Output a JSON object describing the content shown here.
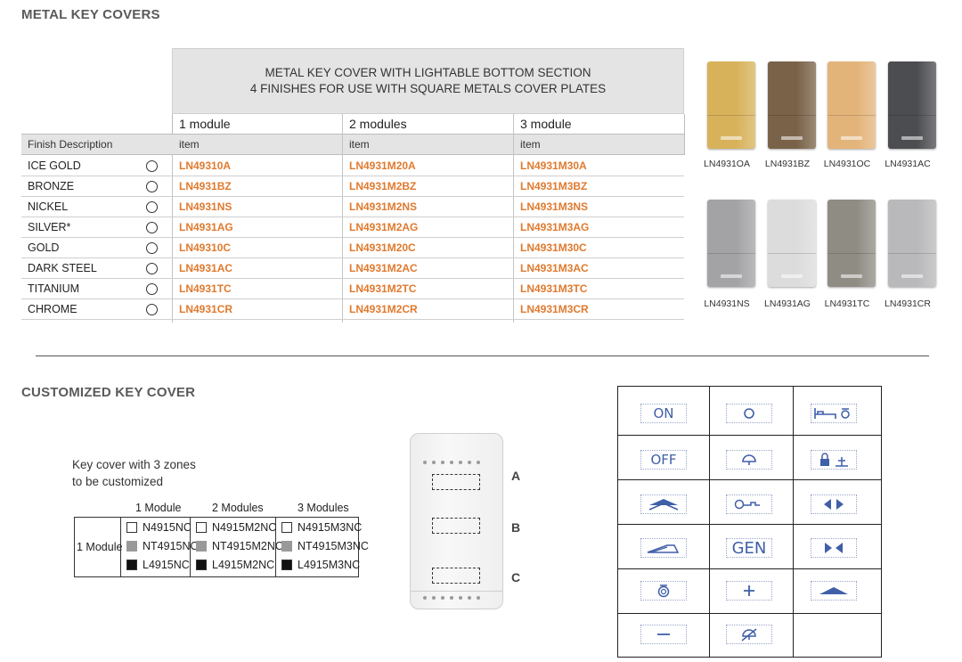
{
  "metal": {
    "title": "METAL KEY COVERS",
    "header_line1": "METAL KEY COVER WITH LIGHTABLE BOTTOM SECTION",
    "header_line2": "4 FINISHES FOR USE WITH SQUARE METALS COVER PLATES",
    "modules": [
      "1 module",
      "2 modules",
      "3 module"
    ],
    "finish_desc_label": "Finish Description",
    "item_label": "item",
    "rows": [
      {
        "finish": "ICE GOLD",
        "m1": "LN49310A",
        "m2": "LN4931M20A",
        "m3": "LN4931M30A"
      },
      {
        "finish": "BRONZE",
        "m1": "LN4931BZ",
        "m2": "LN4931M2BZ",
        "m3": "LN4931M3BZ"
      },
      {
        "finish": "NICKEL",
        "m1": "LN4931NS",
        "m2": "LN4931M2NS",
        "m3": "LN4931M3NS"
      },
      {
        "finish": "SILVER*",
        "m1": "LN4931AG",
        "m2": "LN4931M2AG",
        "m3": "LN4931M3AG"
      },
      {
        "finish": "GOLD",
        "m1": "LN49310C",
        "m2": "LN4931M20C",
        "m3": "LN4931M30C"
      },
      {
        "finish": "DARK STEEL",
        "m1": "LN4931AC",
        "m2": "LN4931M2AC",
        "m3": "LN4931M3AC"
      },
      {
        "finish": "TITANIUM",
        "m1": "LN4931TC",
        "m2": "LN4931M2TC",
        "m3": "LN4931M3TC"
      },
      {
        "finish": "CHROME",
        "m1": "LN4931CR",
        "m2": "LN4931M2CR",
        "m3": "LN4931M3CR"
      }
    ],
    "swatches": [
      {
        "label": "LN4931OA",
        "color": "#d8b25a"
      },
      {
        "label": "LN4931BZ",
        "color": "#7a6248"
      },
      {
        "label": "LN4931OC",
        "color": "#e3b47a"
      },
      {
        "label": "LN4931AC",
        "color": "#4b4d50"
      },
      {
        "label": "LN4931NS",
        "color": "#a3a3a5"
      },
      {
        "label": "LN4931AG",
        "color": "#dcdcdc"
      },
      {
        "label": "LN4931TC",
        "color": "#8f8c84"
      },
      {
        "label": "LN4931CR",
        "color": "#b9b9bb"
      }
    ],
    "accent_color": "#e07a2e"
  },
  "custom": {
    "title": "CUSTOMIZED KEY COVER",
    "desc_line1": "Key cover with 3 zones",
    "desc_line2": "to be customized",
    "col_headers": [
      "1 Module",
      "2 Modules",
      "3 Modules"
    ],
    "row_label": "1 Module",
    "codes": [
      [
        "N4915NC",
        "N4915M2NC",
        "N4915M3NC"
      ],
      [
        "NT4915NC",
        "NT4915M2NC",
        "NT4915M3NC"
      ],
      [
        "L4915NC",
        "L4915M2NC",
        "L4915M3NC"
      ]
    ],
    "zone_labels": [
      "A",
      "B",
      "C"
    ],
    "symbols": [
      {
        "name": "on-symbol",
        "text": "ON"
      },
      {
        "name": "circle-symbol",
        "text": ""
      },
      {
        "name": "bed-light-symbol",
        "text": ""
      },
      {
        "name": "off-symbol",
        "text": "OFF"
      },
      {
        "name": "ceiling-lamp-symbol",
        "text": ""
      },
      {
        "name": "lock-symbol",
        "text": ""
      },
      {
        "name": "shutter-up-symbol",
        "text": ""
      },
      {
        "name": "key-symbol",
        "text": ""
      },
      {
        "name": "arrows-out-symbol",
        "text": ""
      },
      {
        "name": "stairs-light-symbol",
        "text": ""
      },
      {
        "name": "gen-symbol",
        "text": "GEN"
      },
      {
        "name": "arrows-in-symbol",
        "text": ""
      },
      {
        "name": "bell-symbol",
        "text": ""
      },
      {
        "name": "plus-symbol",
        "text": ""
      },
      {
        "name": "up-chevron-symbol",
        "text": ""
      },
      {
        "name": "minus-symbol",
        "text": ""
      },
      {
        "name": "no-lamp-symbol",
        "text": ""
      }
    ]
  }
}
